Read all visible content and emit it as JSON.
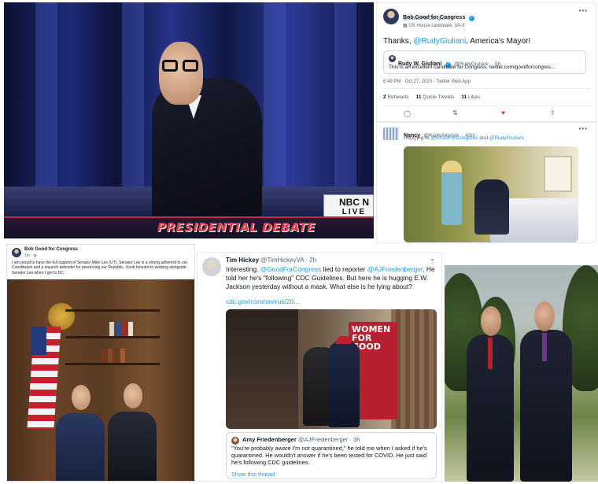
{
  "debate": {
    "banner_title": "PRESIDENTIAL DEBATE",
    "network_logo": "NBC N",
    "network_live": "LIVE"
  },
  "tweet_main": {
    "author_name": "Bob Good for Congress",
    "author_handle": "@GoodForCongress",
    "author_label": "US House candidate, VA-5",
    "text_prefix": "Thanks, ",
    "text_mention": "@RudyGiuliani",
    "text_suffix": ", America's Mayor!",
    "quoted": {
      "name": "Rudy W. Giuliani",
      "handle": "@RudyGiuliani",
      "age": "· 5h",
      "text": "This is an excellent candidate for Congress. twitter.com/goodforcongres..."
    },
    "timestamp": "6:49 PM · Oct 27, 2020 · Twitter Web App",
    "stats": {
      "retweets_count": "2",
      "retweets_label": "Retweets",
      "quotes_count": "11",
      "quotes_label": "Quote Tweets",
      "likes_count": "11",
      "likes_label": "Likes"
    }
  },
  "tweet_reply": {
    "author_name": "Nancy",
    "author_handle": "@KnitNAKinVA",
    "age": "· 43m",
    "replying_prefix": "Replying to ",
    "replying_to_1": "@GoodForCongress",
    "replying_and": " and ",
    "replying_to_2": "@RudyGiuliani"
  },
  "fb_post": {
    "author_name": "Bob Good for Congress",
    "age": "1m · ",
    "text": "I am proud to have the full support of Senator Mike Lee (UT). Senator Lee is a strong adherent to our Constitution and a staunch defender for preserving our Republic. I look forward to working alongside Senator Lee when I get to DC."
  },
  "tweet_tim": {
    "author_name": "Tim Hickey",
    "author_handle": "@TimHickeyVA",
    "age": "· 2h",
    "text_1": "Interesting. ",
    "mention_1": "@GoodForCongress",
    "text_2": " lied to reporter ",
    "mention_2": "@AJFriedenberger",
    "text_3": ". He told her he's \"following\" CDC Guidelines. But here he is hugging E.W. Jackson yesterday without a mask. What else is he lying about?",
    "link": "cdc.gov/coronavirus/20...",
    "photo_sign": "WOMEN FOR GOOD",
    "quoted": {
      "name": "Amy Friedenberger",
      "handle": "@AJFriedenberger",
      "age": "· 3h",
      "text": "\"You're probably aware I'm not quarantined,\" he told me when I asked if he's quarantined. He wouldn't answer if he's been tested for COVID. He just said he's following CDC guidelines.",
      "show_thread": "Show this thread"
    }
  },
  "icons": {
    "reply": "reply-icon",
    "retweet": "retweet-icon",
    "like": "heart-icon",
    "share": "share-icon",
    "verified": "verified-badge-icon",
    "more": "more-dots-icon",
    "chevron": "chevron-down-icon"
  },
  "colors": {
    "twitter_blue": "#1d9bf0",
    "like_red": "#e0245e",
    "debate_red": "#e23b4a"
  }
}
